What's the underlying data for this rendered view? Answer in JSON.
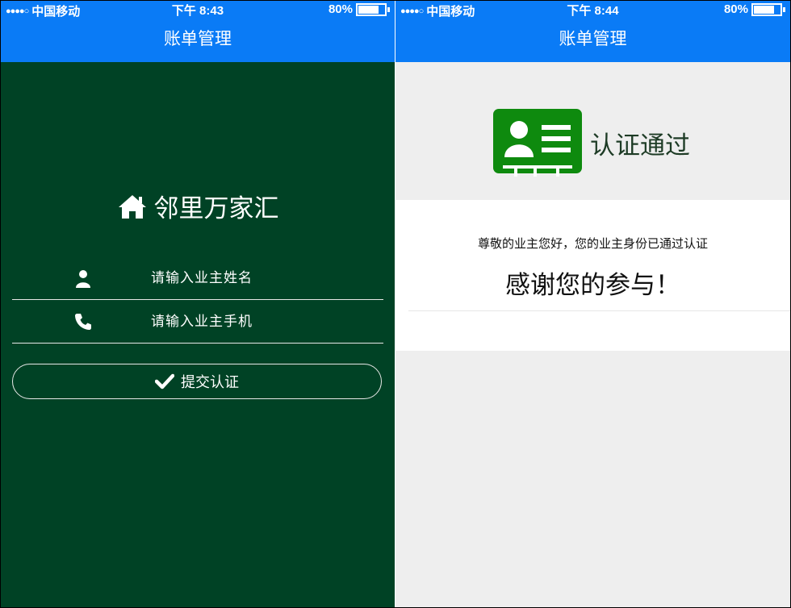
{
  "colors": {
    "primary_blue": "#0a7bf6",
    "dark_green": "#004225",
    "cert_green": "#0e8a0e",
    "bg_gray": "#eeeeee"
  },
  "left": {
    "status": {
      "carrier": "中国移动",
      "time": "下午 8:43",
      "battery": "80%",
      "battery_level": 0.8
    },
    "nav_title": "账单管理",
    "brand": {
      "icon": "home-icon",
      "title": "邻里万家汇"
    },
    "fields": [
      {
        "icon": "user-icon",
        "placeholder": "请输入业主姓名"
      },
      {
        "icon": "phone-icon",
        "placeholder": "请输入业主手机"
      }
    ],
    "submit": {
      "icon": "check-icon",
      "label": "提交认证"
    }
  },
  "right": {
    "status": {
      "carrier": "中国移动",
      "time": "下午 8:44",
      "battery": "80%",
      "battery_level": 0.8
    },
    "nav_title": "账单管理",
    "result": {
      "icon": "id-card-icon",
      "title": "认证通过"
    },
    "message": "尊敬的业主您好，您的业主身份已通过认证",
    "thanks": "感谢您的参与！"
  }
}
